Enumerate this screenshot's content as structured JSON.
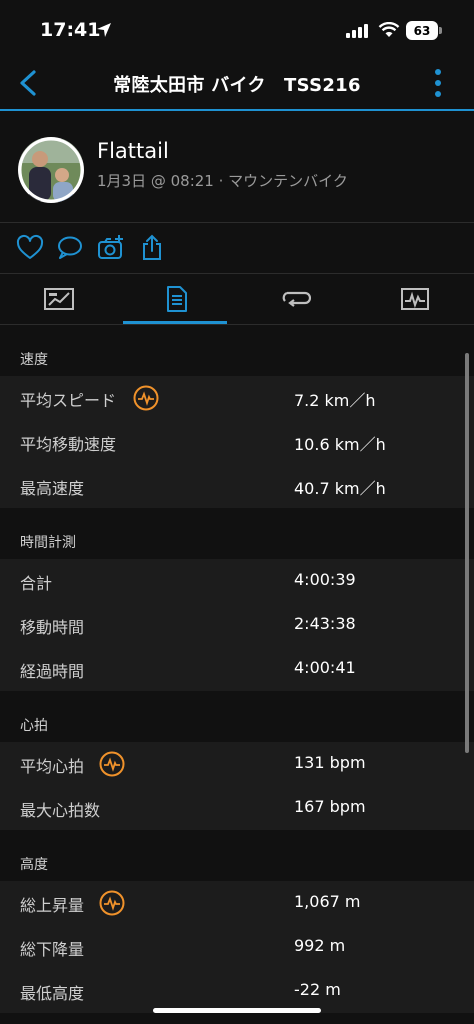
{
  "status_bar": {
    "time": "17:41",
    "battery": "63"
  },
  "nav": {
    "title": "常陸太田市 バイク　TSS216"
  },
  "header": {
    "username": "Flattail",
    "subtitle": "1月3日 @ 08:21 · マウンテンバイク"
  },
  "colors": {
    "accent": "#1f92d2",
    "hr_icon": "#f0922b",
    "background": "#111111",
    "row": "#1c1c1c"
  },
  "icons": {
    "actions": [
      "heart-icon",
      "comment-icon",
      "camera-add-icon",
      "share-icon"
    ],
    "tabs": [
      "overview-tab-icon",
      "stats-tab-icon",
      "laps-tab-icon",
      "charts-tab-icon"
    ]
  },
  "sections": {
    "speed": {
      "title": "速度",
      "rows": [
        {
          "label": "平均スピード",
          "value": "7.2 km／h"
        },
        {
          "label": "平均移動速度",
          "value": "10.6 km／h"
        },
        {
          "label": "最高速度",
          "value": "40.7 km／h"
        }
      ]
    },
    "timing": {
      "title": "時間計測",
      "rows": [
        {
          "label": "合計",
          "value": "4:00:39"
        },
        {
          "label": "移動時間",
          "value": "2:43:38"
        },
        {
          "label": "経過時間",
          "value": "4:00:41"
        }
      ]
    },
    "heart_rate": {
      "title": "心拍",
      "rows": [
        {
          "label": "平均心拍",
          "value": "131 bpm"
        },
        {
          "label": "最大心拍数",
          "value": "167 bpm"
        }
      ]
    },
    "elevation": {
      "title": "高度",
      "rows": [
        {
          "label": "総上昇量",
          "value": "1,067 m"
        },
        {
          "label": "総下降量",
          "value": "992 m"
        },
        {
          "label": "最低高度",
          "value": "-22 m"
        }
      ]
    }
  }
}
